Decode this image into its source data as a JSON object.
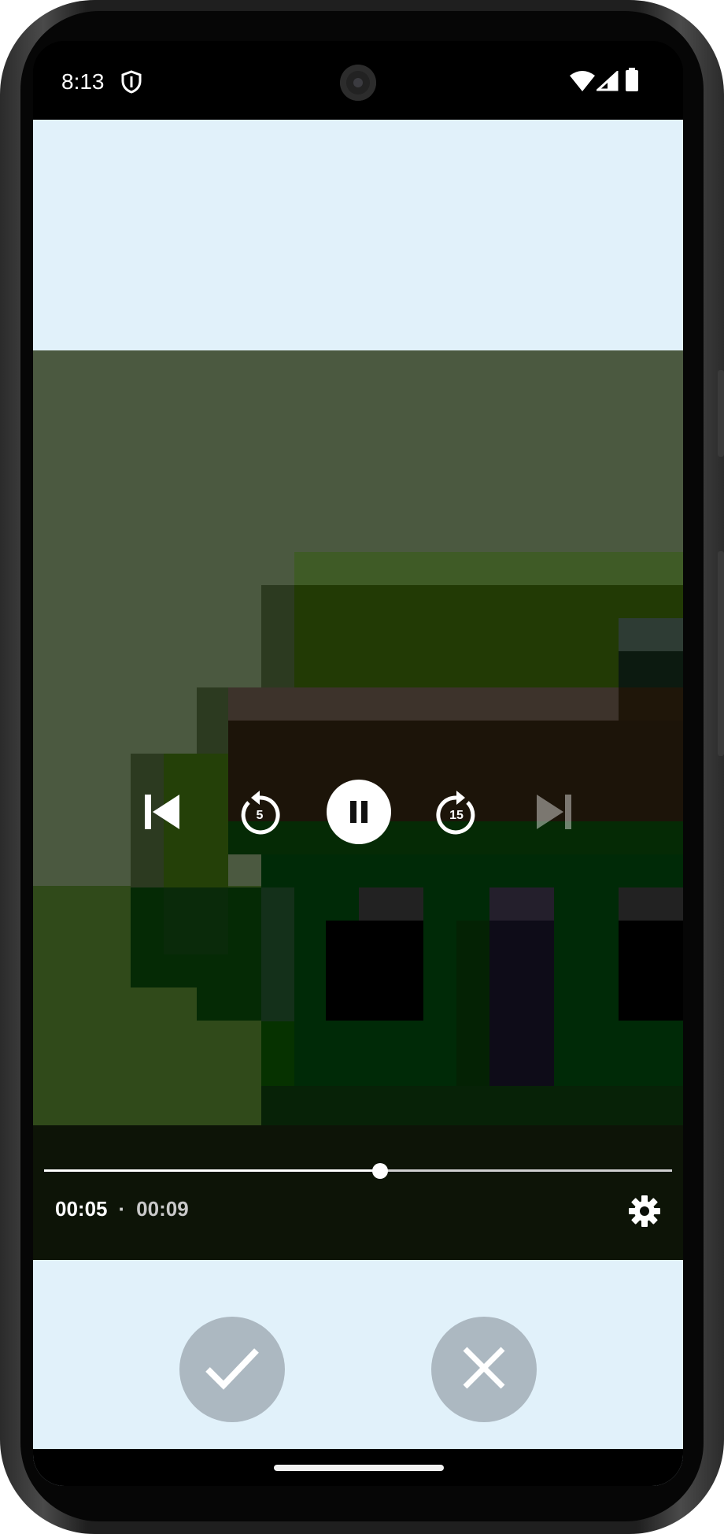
{
  "status_bar": {
    "time": "8:13",
    "icons": [
      "shield-icon",
      "wifi-icon",
      "cell-signal-icon",
      "battery-icon"
    ]
  },
  "player": {
    "controls": [
      "skip-previous-icon",
      "rewind-5-icon",
      "pause-icon",
      "forward-15-icon",
      "skip-next-icon"
    ],
    "rewind_label": "5",
    "forward_label": "15",
    "position": "00:05",
    "separator": "·",
    "duration": "00:09",
    "progress_fraction": 0.535,
    "next_enabled": false
  },
  "actions": {
    "confirm_icon": "check-icon",
    "cancel_icon": "close-icon"
  },
  "colors": {
    "app_background": "#e1f1fa",
    "action_button": "#acb8c1",
    "scrubber": "#ffffff"
  }
}
